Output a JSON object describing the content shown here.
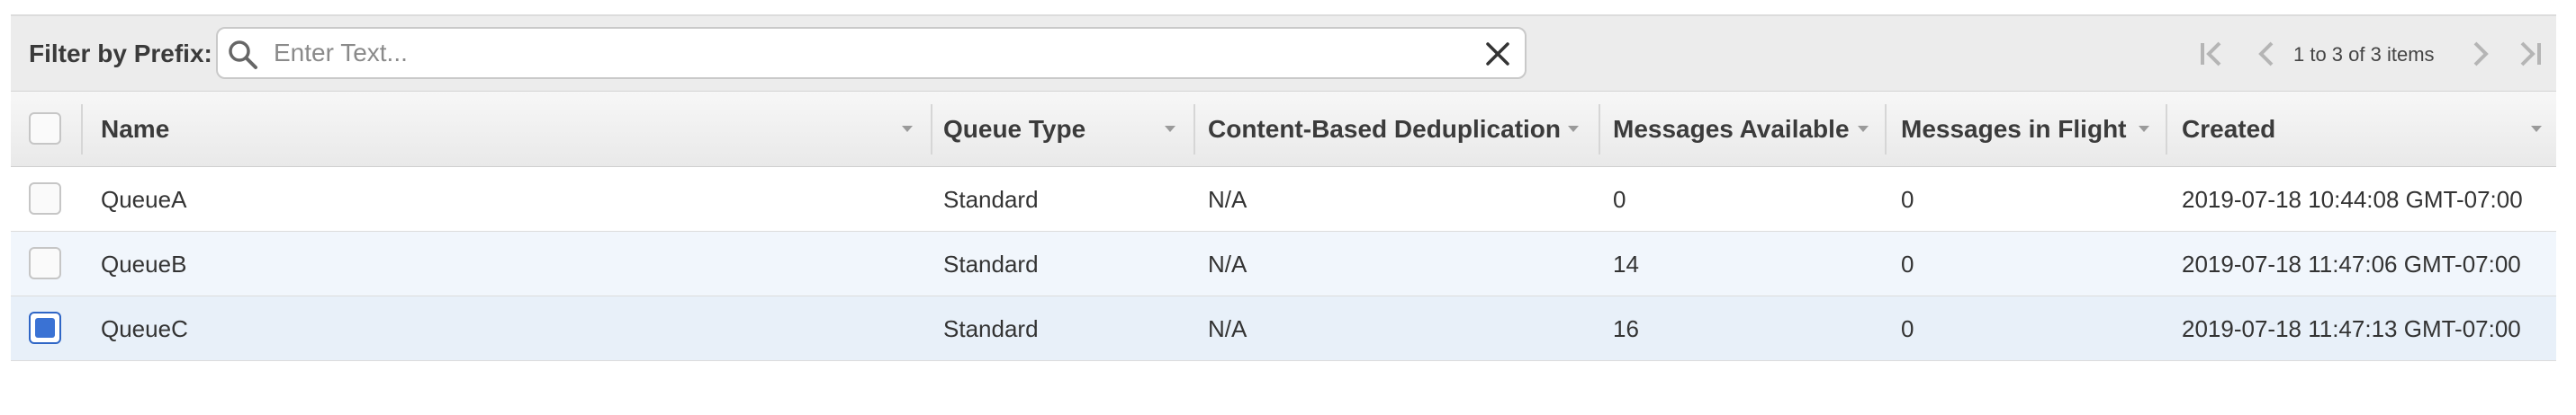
{
  "filter": {
    "label": "Filter by Prefix:",
    "placeholder": "Enter Text...",
    "value": ""
  },
  "pager": {
    "text": "1 to 3 of 3 items",
    "icons": [
      "first-page-icon",
      "previous-page-icon",
      "next-page-icon",
      "last-page-icon"
    ]
  },
  "columns": [
    {
      "key": "name",
      "label": "Name"
    },
    {
      "key": "queue_type",
      "label": "Queue Type"
    },
    {
      "key": "dedup",
      "label": "Content-Based Deduplication"
    },
    {
      "key": "available",
      "label": "Messages Available"
    },
    {
      "key": "in_flight",
      "label": "Messages in Flight"
    },
    {
      "key": "created",
      "label": "Created"
    }
  ],
  "rows": [
    {
      "name": "QueueA",
      "queue_type": "Standard",
      "dedup": "N/A",
      "available": "0",
      "in_flight": "0",
      "created": "2019-07-18 10:44:08 GMT-07:00",
      "checked": false
    },
    {
      "name": "QueueB",
      "queue_type": "Standard",
      "dedup": "N/A",
      "available": "14",
      "in_flight": "0",
      "created": "2019-07-18 11:47:06 GMT-07:00",
      "checked": false
    },
    {
      "name": "QueueC",
      "queue_type": "Standard",
      "dedup": "N/A",
      "available": "16",
      "in_flight": "0",
      "created": "2019-07-18 11:47:13 GMT-07:00",
      "checked": true
    }
  ],
  "colors": {
    "checkbox_checked": "#3a72d4",
    "row_alt": "#f1f6fc",
    "row_selected": "#e8f0f9"
  }
}
